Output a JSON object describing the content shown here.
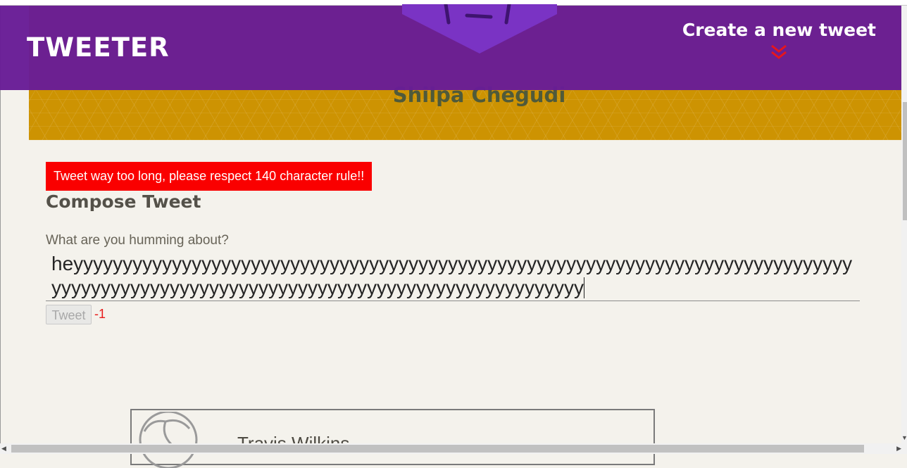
{
  "nav": {
    "logo": "TWEETER",
    "compose_toggle_label": "Create a new tweet",
    "toggle_icon": "double-chevron-down-icon"
  },
  "profile": {
    "name": "Shilpa Chegudi"
  },
  "compose": {
    "error_message": "Tweet way too long, please respect 140 character rule!!",
    "title": "Compose Tweet",
    "prompt_label": "What are you humming about?",
    "text_value": "heyyyyyyyyyyyyyyyyyyyyyyyyyyyyyyyyyyyyyyyyyyyyyyyyyyyyyyyyyyyyyyyyyyyyyyyyyyyyyyyyyyyyyyyyyyyyyyyyyyyyyyyyyyyyyyyyyyyyyyyyyyyyyyyyyyyyy",
    "submit_label": "Tweet",
    "char_counter": "-1"
  },
  "tweets": [
    {
      "author": "Travis Wilkins"
    }
  ],
  "colors": {
    "nav_purple": "#681c96",
    "banner_gold": "#cd9302",
    "error_red": "#fa0000",
    "counter_red": "#e81a1a",
    "page_bg": "#f4f2ec"
  }
}
